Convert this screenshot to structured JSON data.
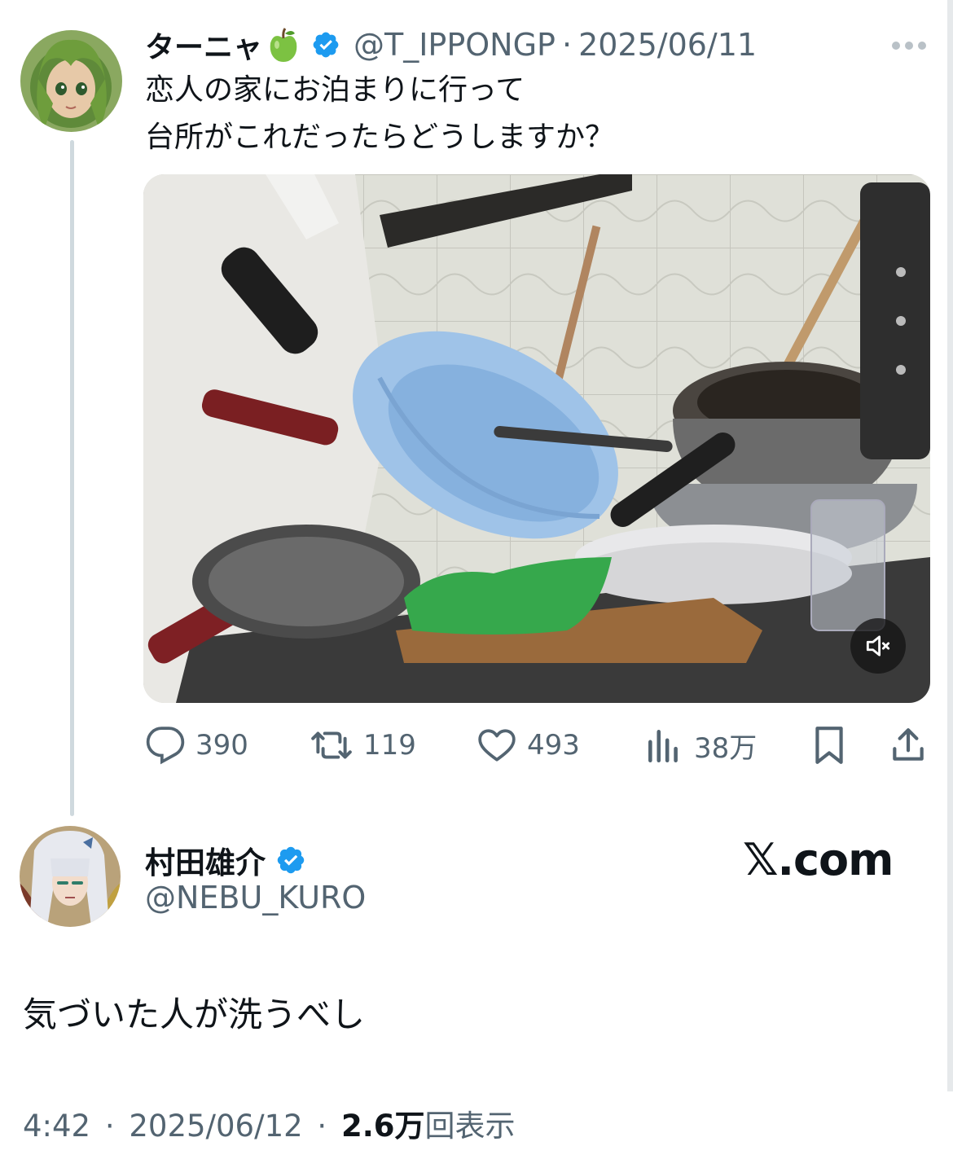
{
  "original_tweet": {
    "display_name": "ターニャ",
    "name_emoji": "green-apple",
    "handle": "@T_IPPONGP",
    "separator": "·",
    "date": "2025/06/11",
    "text_line1": "恋人の家にお泊まりに行って",
    "text_line2": "台所がこれだったらどうしますか？",
    "media": {
      "type": "video",
      "description_icon": "muted-speaker-icon"
    },
    "actions": {
      "replies": "390",
      "retweets": "119",
      "likes": "493",
      "views": "38万"
    }
  },
  "reply_tweet": {
    "display_name": "村田雄介",
    "handle": "@NEBU_KURO",
    "text": "気づいた人が洗うべし",
    "time": "4:42",
    "separator": "·",
    "date": "2025/06/12",
    "views_count": "2.6万",
    "views_label": "回表示"
  },
  "watermark": "𝕏.com",
  "colors": {
    "verified": "#1d9bf0",
    "muted_text": "#536471",
    "text": "#0f1419",
    "thread_line": "#cfd9de"
  }
}
